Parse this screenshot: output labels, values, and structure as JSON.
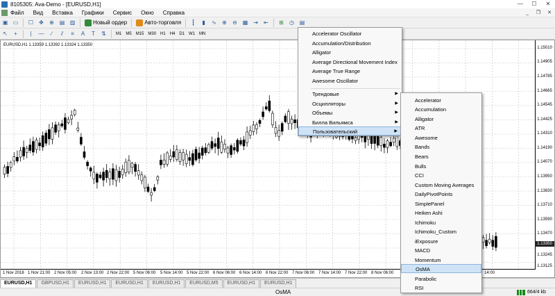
{
  "window": {
    "title": "8105305: Ava-Demo - [EURUSD,H1]",
    "minimize": "—",
    "maximize": "☐",
    "close": "✕"
  },
  "menu": {
    "items": [
      "Файл",
      "Вид",
      "Вставка",
      "Графики",
      "Сервис",
      "Окно",
      "Справка"
    ],
    "doc_minimize": "_",
    "doc_restore": "❐",
    "doc_close": "✕"
  },
  "toolbar": {
    "new_order": "Новый ордер",
    "auto_trading": "Авто-торговля"
  },
  "timeframes": [
    "M1",
    "M5",
    "M15",
    "M30",
    "H1",
    "H4",
    "D1",
    "W1",
    "MN"
  ],
  "chart": {
    "info": "EURUSD,H1  1.13359 1.13392 1.13324 1.13350",
    "current_price": "1.13350",
    "price_labels": [
      "1.15010",
      "1.14905",
      "1.14785",
      "1.14665",
      "1.14545",
      "1.14425",
      "1.14310",
      "1.14190",
      "1.14070",
      "1.13950",
      "1.13830",
      "1.13710",
      "1.13590",
      "1.13470",
      "1.13245",
      "1.13125"
    ],
    "time_labels": [
      "1 Nov 2018",
      "1 Nov 21:00",
      "2 Nov 05:00",
      "2 Nov 13:00",
      "2 Nov 22:00",
      "5 Nov 06:00",
      "5 Nov 14:00",
      "5 Nov 22:00",
      "6 Nov 06:00",
      "6 Nov 14:00",
      "6 Nov 22:00",
      "7 Nov 06:00",
      "7 Nov 14:00",
      "7 Nov 22:00",
      "8 Nov 06:00",
      "14:00"
    ]
  },
  "indicators_menu": {
    "top": [
      "Accelerator Oscillator",
      "Accumulation/Distribution",
      "Alligator",
      "Average Directional Movement Index",
      "Average True Range",
      "Awesome Oscillator"
    ],
    "groups": [
      "Трендовые",
      "Осцилляторы",
      "Объемы",
      "Билла Вильямса",
      "Пользовательский"
    ]
  },
  "custom_menu": [
    "Accelerator",
    "Accumulation",
    "Alligator",
    "ATR",
    "Awesome",
    "Bands",
    "Bears",
    "Bulls",
    "CCI",
    "Custom Moving Averages",
    "DailyPivotPoints",
    "SimplePanel",
    "Heiken Ashi",
    "Ichimoku",
    "Ichimoku_Custom",
    "iExposure",
    "MACD",
    "Momentum",
    "OsMA",
    "Parabolic",
    "RSI"
  ],
  "tabs": [
    "EURUSD,H1",
    "GBPUSD,H1",
    "EURUSD,H1",
    "EURUSD,H1",
    "EURUSD,H1",
    "EURUSD,M5",
    "EURUSD,H1",
    "EURUSD,H1"
  ],
  "status": {
    "text": "OsMA",
    "traffic": "664/4 kb"
  },
  "colors": {
    "highlight": "#cfe3f7",
    "candle": "#000000",
    "grid": "#c0c0c0"
  }
}
